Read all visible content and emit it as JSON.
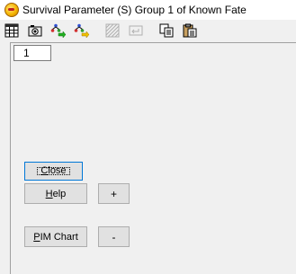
{
  "window": {
    "title": "Survival Parameter (S) Group 1 of Known Fate",
    "icon": "app-icon"
  },
  "toolbar": {
    "buttons": [
      {
        "name": "grid-icon"
      },
      {
        "name": "camera-icon"
      },
      {
        "name": "tree-arrow-icon"
      },
      {
        "name": "tree-arrow-yellow-icon"
      },
      {
        "name": "hatch-disabled-icon"
      },
      {
        "name": "return-disabled-icon"
      },
      {
        "name": "copy-icon"
      },
      {
        "name": "paste-icon"
      }
    ]
  },
  "field": {
    "value": "1"
  },
  "buttons": {
    "close": {
      "accel": "C",
      "rest": "lose"
    },
    "help": {
      "accel": "H",
      "rest": "elp"
    },
    "plus": "+",
    "pim": {
      "accel": "P",
      "rest": "IM Chart"
    },
    "minus": "-"
  }
}
